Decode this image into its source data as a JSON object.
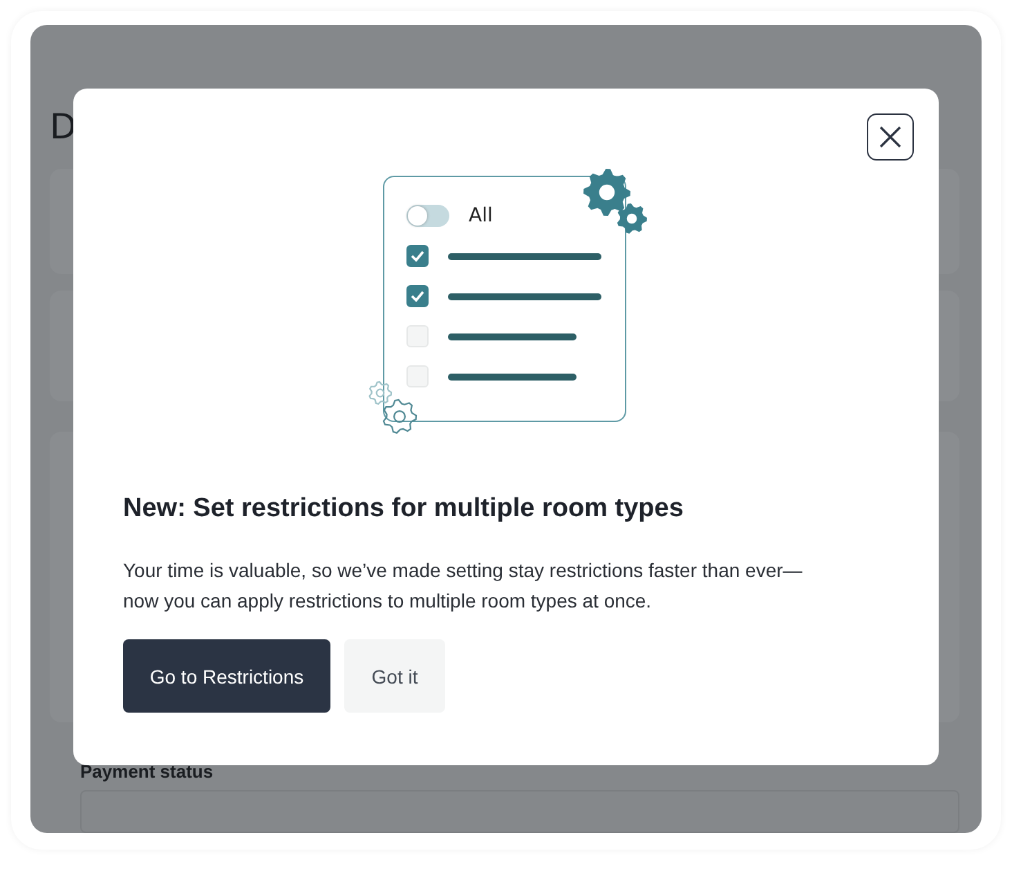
{
  "page": {
    "heading": "D",
    "payment_label": "Payment status"
  },
  "dialog": {
    "title": "New: Set restrictions for multiple room types",
    "body": "Your time is valuable, so we’ve made setting stay restrictions faster than ever—now you can apply restrictions to multiple room types at once.",
    "illustration": {
      "toggle": {
        "label": "All",
        "on": false
      },
      "rows": [
        {
          "checked": true
        },
        {
          "checked": true
        },
        {
          "checked": false
        },
        {
          "checked": false
        }
      ]
    },
    "buttons": [
      {
        "label": "Go to Restrictions",
        "kind": "primary"
      },
      {
        "label": "Got it",
        "kind": "secondary"
      }
    ]
  }
}
